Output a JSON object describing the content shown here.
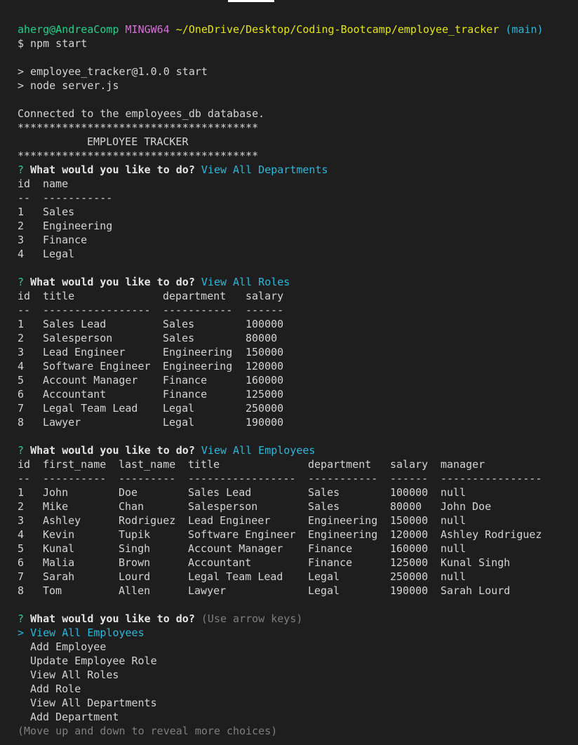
{
  "prompt": {
    "user_host": "aherg@AndreaComp",
    "shell": "MINGW64",
    "path": "~/OneDrive/Desktop/Coding-Bootcamp/employee_tracker",
    "branch": "(main)",
    "command": "$ npm start"
  },
  "npm_output": {
    "line1": "> employee_tracker@1.0.0 start",
    "line2": "> node server.js"
  },
  "banner": {
    "connected": "Connected to the employees_db database.",
    "stars_top": "**************************************",
    "title": "EMPLOYEE TRACKER",
    "stars_bottom": "**************************************"
  },
  "question_mark": "?",
  "question_text": "What would you like to do?",
  "q1_answer": "View All Departments",
  "departments": {
    "headers": [
      "id",
      "name"
    ],
    "dashes": [
      "--",
      "-----------"
    ],
    "rows": [
      [
        "1",
        "Sales"
      ],
      [
        "2",
        "Engineering"
      ],
      [
        "3",
        "Finance"
      ],
      [
        "4",
        "Legal"
      ]
    ]
  },
  "q2_answer": "View All Roles",
  "roles": {
    "headers": [
      "id",
      "title",
      "department",
      "salary"
    ],
    "dashes": [
      "--",
      "-----------------",
      "-----------",
      "------"
    ],
    "rows": [
      [
        "1",
        "Sales Lead",
        "Sales",
        "100000"
      ],
      [
        "2",
        "Salesperson",
        "Sales",
        "80000"
      ],
      [
        "3",
        "Lead Engineer",
        "Engineering",
        "150000"
      ],
      [
        "4",
        "Software Engineer",
        "Engineering",
        "120000"
      ],
      [
        "5",
        "Account Manager",
        "Finance",
        "160000"
      ],
      [
        "6",
        "Accountant",
        "Finance",
        "125000"
      ],
      [
        "7",
        "Legal Team Lead",
        "Legal",
        "250000"
      ],
      [
        "8",
        "Lawyer",
        "Legal",
        "190000"
      ]
    ]
  },
  "q3_answer": "View All Employees",
  "employees": {
    "headers": [
      "id",
      "first_name",
      "last_name",
      "title",
      "department",
      "salary",
      "manager"
    ],
    "dashes": [
      "--",
      "----------",
      "---------",
      "-----------------",
      "-----------",
      "------",
      "----------------"
    ],
    "rows": [
      [
        "1",
        "John",
        "Doe",
        "Sales Lead",
        "Sales",
        "100000",
        "null"
      ],
      [
        "2",
        "Mike",
        "Chan",
        "Salesperson",
        "Sales",
        "80000",
        "John Doe"
      ],
      [
        "3",
        "Ashley",
        "Rodriguez",
        "Lead Engineer",
        "Engineering",
        "150000",
        "null"
      ],
      [
        "4",
        "Kevin",
        "Tupik",
        "Software Engineer",
        "Engineering",
        "120000",
        "Ashley Rodriguez"
      ],
      [
        "5",
        "Kunal",
        "Singh",
        "Account Manager",
        "Finance",
        "160000",
        "null"
      ],
      [
        "6",
        "Malia",
        "Brown",
        "Accountant",
        "Finance",
        "125000",
        "Kunal Singh"
      ],
      [
        "7",
        "Sarah",
        "Lourd",
        "Legal Team Lead",
        "Legal",
        "250000",
        "null"
      ],
      [
        "8",
        "Tom",
        "Allen",
        "Lawyer",
        "Legal",
        "190000",
        "Sarah Lourd"
      ]
    ]
  },
  "q4_hint": "(Use arrow keys)",
  "menu": {
    "pointer": ">",
    "selected": "View All Employees",
    "options": [
      "Add Employee",
      "Update Employee Role",
      "View All Roles",
      "Add Role",
      "View All Departments",
      "Add Department"
    ],
    "footer": "(Move up and down to reveal more choices)"
  }
}
